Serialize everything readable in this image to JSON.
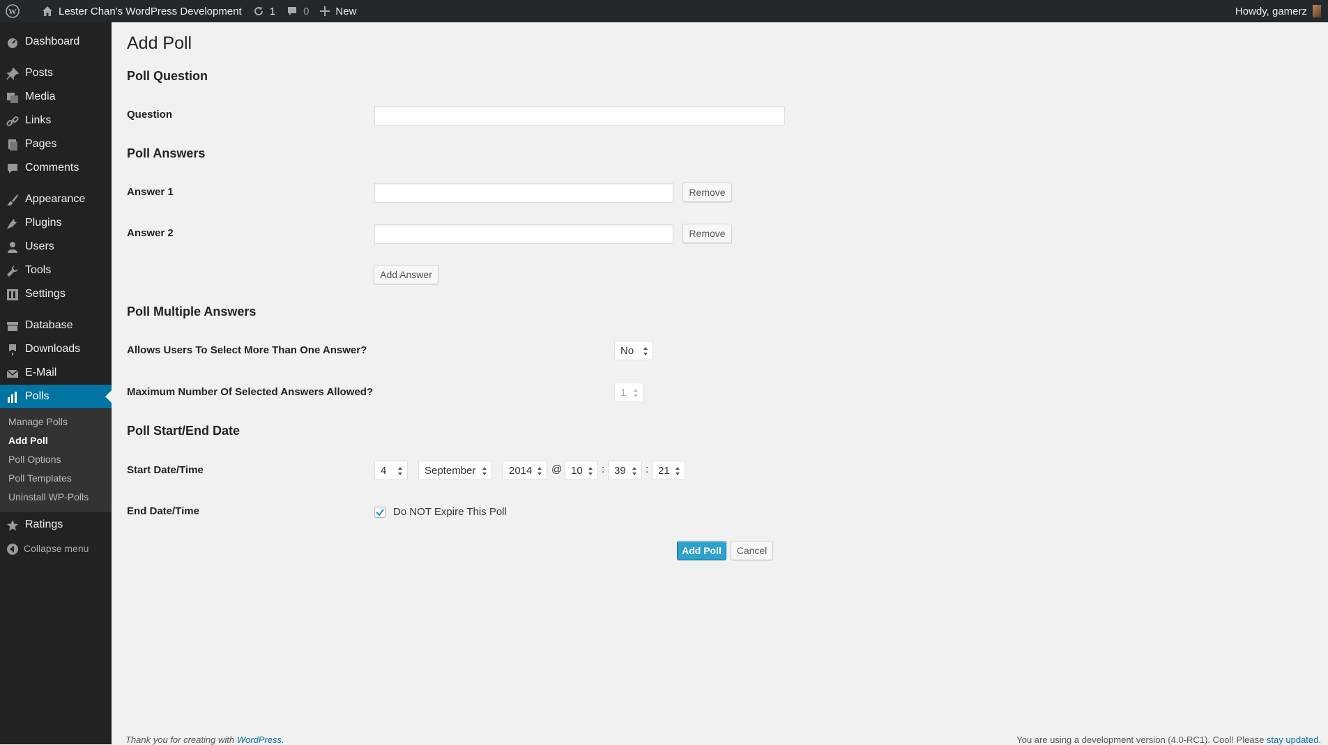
{
  "adminbar": {
    "site_name": "Lester Chan's WordPress Development",
    "updates_count": "1",
    "comments_count": "0",
    "new_label": "New",
    "howdy": "Howdy, gamerz"
  },
  "sidebar": {
    "items": [
      {
        "label": "Dashboard",
        "icon": "dashboard-icon"
      },
      {
        "label": "Posts",
        "icon": "pin-icon"
      },
      {
        "label": "Media",
        "icon": "media-icon"
      },
      {
        "label": "Links",
        "icon": "link-icon"
      },
      {
        "label": "Pages",
        "icon": "pages-icon"
      },
      {
        "label": "Comments",
        "icon": "comment-icon"
      },
      {
        "label": "Appearance",
        "icon": "brush-icon"
      },
      {
        "label": "Plugins",
        "icon": "plug-icon"
      },
      {
        "label": "Users",
        "icon": "user-icon"
      },
      {
        "label": "Tools",
        "icon": "wrench-icon"
      },
      {
        "label": "Settings",
        "icon": "settings-icon"
      },
      {
        "label": "Database",
        "icon": "database-icon"
      },
      {
        "label": "Downloads",
        "icon": "download-icon"
      },
      {
        "label": "E-Mail",
        "icon": "mail-icon"
      },
      {
        "label": "Polls",
        "icon": "chart-bar-icon"
      },
      {
        "label": "Ratings",
        "icon": "star-icon"
      }
    ],
    "submenu": [
      "Manage Polls",
      "Add Poll",
      "Poll Options",
      "Poll Templates",
      "Uninstall WP-Polls"
    ],
    "collapse_label": "Collapse menu"
  },
  "page": {
    "title": "Add Poll",
    "poll_question_heading": "Poll Question",
    "question_label": "Question",
    "question_value": "",
    "poll_answers_heading": "Poll Answers",
    "answers": [
      {
        "label": "Answer 1",
        "value": "",
        "remove_label": "Remove"
      },
      {
        "label": "Answer 2",
        "value": "",
        "remove_label": "Remove"
      }
    ],
    "add_answer_label": "Add Answer",
    "multiple_heading": "Poll Multiple Answers",
    "multiple_q1": "Allows Users To Select More Than One Answer?",
    "multiple_q1_value": "No",
    "multiple_q2": "Maximum Number Of Selected Answers Allowed?",
    "multiple_q2_value": "1",
    "date_heading": "Poll Start/End Date",
    "start_label": "Start Date/Time",
    "start": {
      "day": "4",
      "month": "September",
      "year": "2014",
      "at": "@",
      "hour": "10",
      "minute": "39",
      "second": "21",
      "colon": ":"
    },
    "end_label": "End Date/Time",
    "no_expire_label": "Do NOT Expire This Poll",
    "no_expire_checked": true,
    "add_poll_label": "Add Poll",
    "cancel_label": "Cancel"
  },
  "footer": {
    "left_text": "Thank you for creating with ",
    "left_link": "WordPress",
    "left_end": ".",
    "right_text": "You are using a development version (4.0-RC1). Cool! Please ",
    "right_link": "stay updated",
    "right_end": "."
  },
  "colors": {
    "primary": "#2ea2cc",
    "sidebar_bg": "#222222",
    "current_menu": "#0074a2"
  }
}
